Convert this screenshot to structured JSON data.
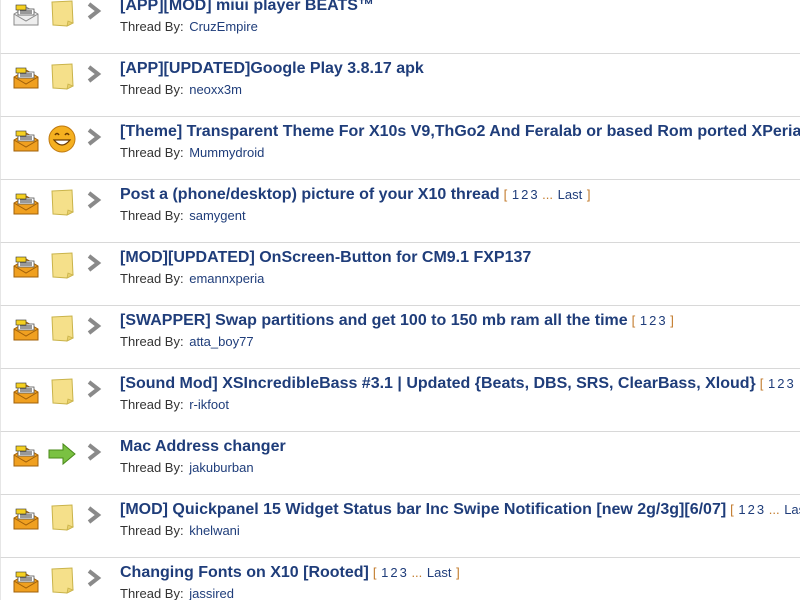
{
  "thread_by_label": "Thread By:",
  "pagination_text": {
    "open_bracket": "[",
    "close_bracket": "]",
    "ellipsis": "...",
    "last": "Last",
    "last_abbrev": "Las"
  },
  "threads": [
    {
      "title": "[APP][MOD] miui player BEATS™",
      "author": "CruzEmpire",
      "status_icon": "envelope-read-icon",
      "post_icon": "note-icon",
      "pages": []
    },
    {
      "title": "[APP][UPDATED]Google Play 3.8.17 apk",
      "author": "neoxx3m",
      "status_icon": "envelope-hot-icon",
      "post_icon": "note-icon",
      "pages": []
    },
    {
      "title": "[Theme] Transparent Theme For X10s V9,ThGo2 And Feralab or based Rom ported XPeria",
      "author": "Mummydroid",
      "status_icon": "envelope-hot-icon",
      "post_icon": "smiley-icon",
      "pages": []
    },
    {
      "title": "Post a (phone/desktop) picture of your X10 thread",
      "author": "samygent",
      "status_icon": "envelope-hot-icon",
      "post_icon": "note-icon",
      "pages": [
        "1",
        "2",
        "3"
      ],
      "pages_ellipsis": true,
      "pages_last": "Last"
    },
    {
      "title": "[MOD][UPDATED] OnScreen-Button for CM9.1 FXP137",
      "author": "emannxperia",
      "status_icon": "envelope-hot-icon",
      "post_icon": "note-icon",
      "pages": []
    },
    {
      "title": "[SWAPPER] Swap partitions and get 100 to 150 mb ram all the time",
      "author": "atta_boy77",
      "status_icon": "envelope-hot-icon",
      "post_icon": "note-icon",
      "pages": [
        "1",
        "2",
        "3"
      ],
      "pages_ellipsis": false,
      "pages_last": ""
    },
    {
      "title": "[Sound Mod] XSIncredibleBass #3.1 | Updated {Beats, DBS, SRS, ClearBass, Xloud}",
      "author": "r-ikfoot",
      "status_icon": "envelope-hot-icon",
      "post_icon": "note-icon",
      "pages": [
        "1",
        "2",
        "3"
      ],
      "pages_ellipsis": false,
      "pages_last": "",
      "pages_truncated": true
    },
    {
      "title": "Mac Address changer",
      "author": "jakuburban",
      "status_icon": "envelope-hot-icon",
      "post_icon": "green-arrow-icon",
      "pages": []
    },
    {
      "title": "[MOD] Quickpanel 15 Widget Status bar Inc Swipe Notification [new 2g/3g][6/07]",
      "author": "khelwani",
      "status_icon": "envelope-hot-icon",
      "post_icon": "note-icon",
      "pages": [
        "1",
        "2",
        "3"
      ],
      "pages_ellipsis": true,
      "pages_last": "Las"
    },
    {
      "title": "Changing Fonts on X10 [Rooted]",
      "author": "jassired",
      "status_icon": "envelope-hot-icon",
      "post_icon": "note-icon",
      "pages": [
        "1",
        "2",
        "3"
      ],
      "pages_ellipsis": true,
      "pages_last": "Last"
    }
  ],
  "colors": {
    "title": "#1f3d7a",
    "pagination_bracket": "#c27a2b",
    "row_border": "#d8d8d8",
    "envelope_hot": "#f0a020",
    "note": "#f5e08a",
    "arrow_gray": "#8a8a8a"
  }
}
